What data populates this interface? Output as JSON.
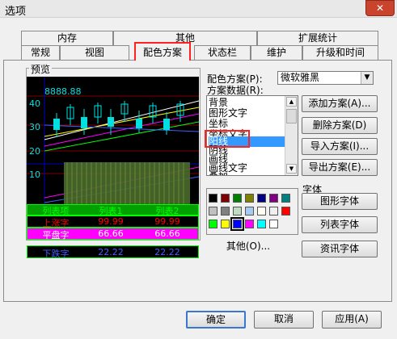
{
  "window": {
    "title": "选项",
    "close_glyph": "✕"
  },
  "tabs": {
    "row_back": [
      "内存",
      "其他",
      "扩展统计"
    ],
    "row_front": [
      "常规",
      "视图",
      "配色方案",
      "状态栏",
      "维护",
      "升级和时间"
    ],
    "active": "配色方案"
  },
  "preview": {
    "group_label": "预览",
    "price": "8888.88",
    "y_ticks": [
      "40",
      "30",
      "20",
      "10"
    ],
    "table": {
      "headers": [
        "列表项",
        "列表1",
        "列表2"
      ],
      "rows": [
        {
          "label": "上涨字",
          "v1": "99.99",
          "v2": "99.99"
        },
        {
          "label": "平盘字",
          "v1": "66.66",
          "v2": "66.66"
        },
        {
          "label": "下跌字",
          "v1": "22.22",
          "v2": "22.22"
        }
      ]
    },
    "colors": {
      "bg": "#000000",
      "up": "#ff0000",
      "flat": "#ff00ff",
      "down": "#0000ff",
      "header": "#00a000",
      "text_green": "#00ff00",
      "cyan": "#00e0e0",
      "grid": "#800000"
    }
  },
  "scheme": {
    "label": "配色方案(P):",
    "selected": "微软雅黑",
    "data_label": "方案数据(R):",
    "items": [
      "背景",
      "图形文字",
      "坐标",
      "坐标文字",
      "阳线",
      "阴线",
      "画线",
      "画线文字",
      "叠加"
    ],
    "selected_item": "阳线",
    "highlight_color": "#3399ff",
    "annotation_color": "#ff2020"
  },
  "buttons": {
    "add": "添加方案(A)...",
    "delete": "删除方案(D)",
    "import": "导入方案(I)...",
    "export": "导出方案(E)...",
    "other": "其他(O)...",
    "ok": "确定",
    "cancel": "取消",
    "apply": "应用(A)"
  },
  "fonts": {
    "group_label": "字体",
    "graph": "图形字体",
    "list": "列表字体",
    "info": "资讯字体"
  },
  "palette": {
    "row1": [
      "#000000",
      "#800000",
      "#008000",
      "#808000",
      "#000080",
      "#800080",
      "#008080"
    ],
    "row2": [
      "#c0c0c0",
      "#808080",
      "#c0dcc0",
      "#a6caf0",
      "#fffbf0",
      "#f0f0f0",
      "#ff0000"
    ],
    "row3": [
      "#00ff00",
      "#ffff00",
      "#0000ff",
      "#ff00ff",
      "#00ffff",
      "#ffffff"
    ],
    "selected_index": 2
  }
}
